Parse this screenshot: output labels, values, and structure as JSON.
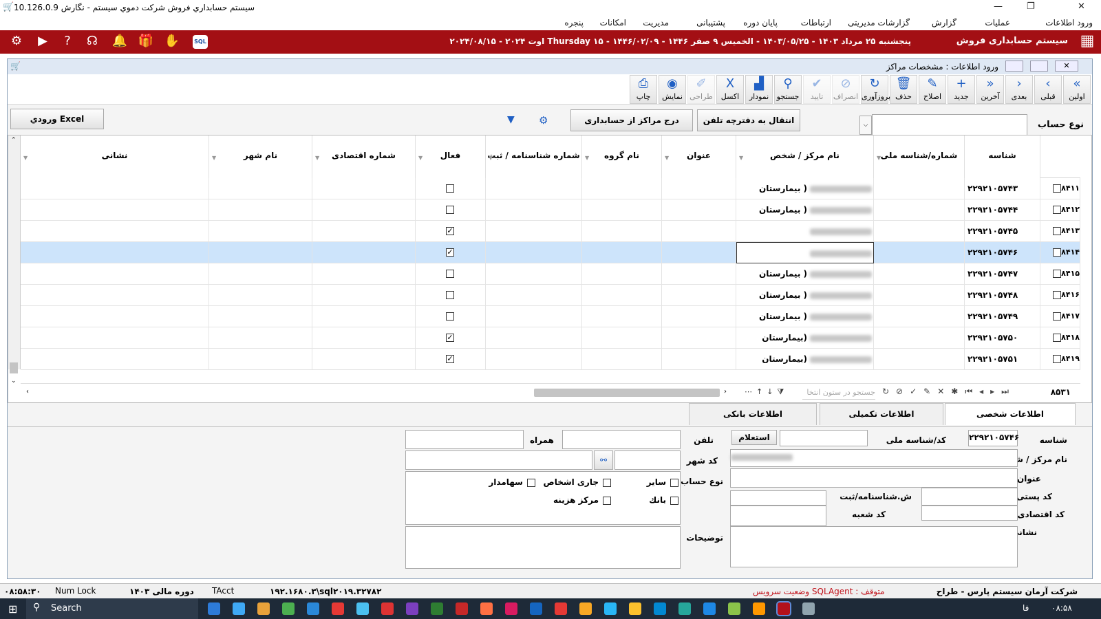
{
  "window": {
    "title": "سيستم حسابداري فروش شركت دموي سيستم - نگارش 10.126.0.9",
    "min": "—",
    "max": "❐",
    "close": "✕"
  },
  "menu": [
    "ورود اطلاعات",
    "عمليات",
    "گزارش",
    "گزارشات مديريتی",
    "ارتباطات",
    "پايان دوره",
    "پشتيبانی",
    "مديريت",
    "امكانات",
    "پنجره"
  ],
  "redbar": {
    "app_name": "سيستم حسابداری فروش",
    "date_text": "پنجشنبه ۲۵ مرداد ۱۴۰۳ - ۱۴۰۳/۰۵/۲۵ - الخميس ۹ صفر ۱۴۴۶ - ۱۴۴۶/۰۲/۰۹ - Thursday ۱۵ اوت ۲۰۲۴ - ۲۰۲۴/۰۸/۱۵",
    "sql_badge": "SQL"
  },
  "inner": {
    "title": "ورود اطلاعات : مشخصات مراكز"
  },
  "toolbar": [
    {
      "label": "اولين",
      "glyph": "«",
      "enabled": true
    },
    {
      "label": "قبلی",
      "glyph": "‹",
      "enabled": true
    },
    {
      "label": "بعدی",
      "glyph": "›",
      "enabled": true
    },
    {
      "label": "آخرين",
      "glyph": "»",
      "enabled": true
    },
    {
      "label": "جديد",
      "glyph": "+",
      "enabled": true
    },
    {
      "label": "اصلاح",
      "glyph": "✎",
      "enabled": true
    },
    {
      "label": "حذف",
      "glyph": "🗑",
      "enabled": true
    },
    {
      "label": "بروزآوری",
      "glyph": "↻",
      "enabled": true
    },
    {
      "label": "انصراف",
      "glyph": "⊘",
      "enabled": false
    },
    {
      "label": "تاييد",
      "glyph": "✔",
      "enabled": false
    },
    {
      "label": "جستجو",
      "glyph": "⚲",
      "enabled": true
    },
    {
      "label": "نمودار",
      "glyph": "▟",
      "enabled": true
    },
    {
      "label": "اكسل",
      "glyph": "X",
      "enabled": true
    },
    {
      "label": "طراحی",
      "glyph": "✐",
      "enabled": false
    },
    {
      "label": "نمايش",
      "glyph": "◉",
      "enabled": true
    },
    {
      "label": "چاپ",
      "glyph": "⎙",
      "enabled": true
    }
  ],
  "filter": {
    "account_type_label": "نوع حساب",
    "account_type_value": "",
    "transfer_btn": "انتقال به دفترچه تلفن",
    "insert_btn": "درج مراكز از حسابداری",
    "excel_btn": "ورودي Excel"
  },
  "grid": {
    "columns": [
      "شناسه",
      "شماره/شناسه ملی",
      "نام مركز / شخص",
      "عنوان",
      "نام گروه",
      "شماره شناسنامه / ثبت",
      "فعال",
      "شماره اقتصادی",
      "نام شهر",
      "نشانی"
    ],
    "rows": [
      {
        "rownum": "۸۴۱۱",
        "id": "۲۲۹۲۱۰۵۷۴۳",
        "name": "( بيمارستان",
        "active": false,
        "selected": false
      },
      {
        "rownum": "۸۴۱۲",
        "id": "۲۲۹۲۱۰۵۷۴۴",
        "name": "( بيمارستان",
        "active": false,
        "selected": false
      },
      {
        "rownum": "۸۴۱۳",
        "id": "۲۲۹۲۱۰۵۷۴۵",
        "name": "",
        "active": true,
        "selected": false
      },
      {
        "rownum": "۸۴۱۴",
        "id": "۲۲۹۲۱۰۵۷۴۶",
        "name": "",
        "active": true,
        "selected": true
      },
      {
        "rownum": "۸۴۱۵",
        "id": "۲۲۹۲۱۰۵۷۴۷",
        "name": "( بيمارستان",
        "active": false,
        "selected": false
      },
      {
        "rownum": "۸۴۱۶",
        "id": "۲۲۹۲۱۰۵۷۴۸",
        "name": "( بيمارستان",
        "active": false,
        "selected": false
      },
      {
        "rownum": "۸۴۱۷",
        "id": "۲۲۹۲۱۰۵۷۴۹",
        "name": "( بيمارستان",
        "active": false,
        "selected": false
      },
      {
        "rownum": "۸۴۱۸",
        "id": "۲۲۹۲۱۰۵۷۵۰",
        "name": "(بيمارستان",
        "active": true,
        "selected": false
      },
      {
        "rownum": "۸۴۱۹",
        "id": "۲۲۹۲۱۰۵۷۵۱",
        "name": "(بيمارستان",
        "active": true,
        "selected": false
      }
    ],
    "footer_count": "۸۵۳۱",
    "search_placeholder": "جستجو در ستون انتخا"
  },
  "tabs": [
    "اطلاعات شخصی",
    "اطلاعات تكميلی",
    "اطلاعات بانكی"
  ],
  "form": {
    "id_label": "شناسه",
    "id_value": "۲۲۹۲۱۰۵۷۴۶",
    "national_label": "كد/شناسه ملی",
    "inquiry_btn": "استعلام",
    "name_label": "نام مركز / شخص",
    "title_label": "عنوان",
    "postal_label": "كد پستی",
    "birth_label": "ش.شناسنامه/ثبت",
    "eco_label": "كد اقتصادی",
    "branch_label": "كد شعبه",
    "address_label": "نشانی",
    "phone_label": "تلفن",
    "mobile_label": "همراه",
    "city_label": "كد شهر",
    "acct_label": "نوع حساب",
    "notes_label": "توضيحات",
    "chk_other": "ساير",
    "chk_current": "جاری اشخاص",
    "chk_share": "سهامدار",
    "chk_bank": "بانك",
    "chk_cost": "مركز هزينه"
  },
  "status": {
    "company": "شركت آرمان سيستم پارس - طراح",
    "service": "متوقف : SQLAgent وضعيت سرويس",
    "server": "۱۹۲.۱۶۸۰.۳\\sql۲۰۱۹.۳۲۷۸۲",
    "app": "TAcct",
    "period": "دوره مالی ۱۴۰۳",
    "numlock": "Num Lock",
    "time": "۰۸:۵۸:۳۰"
  },
  "taskbar": {
    "search": "Search",
    "time": "۰۸:۵۸",
    "lang": "فا"
  }
}
